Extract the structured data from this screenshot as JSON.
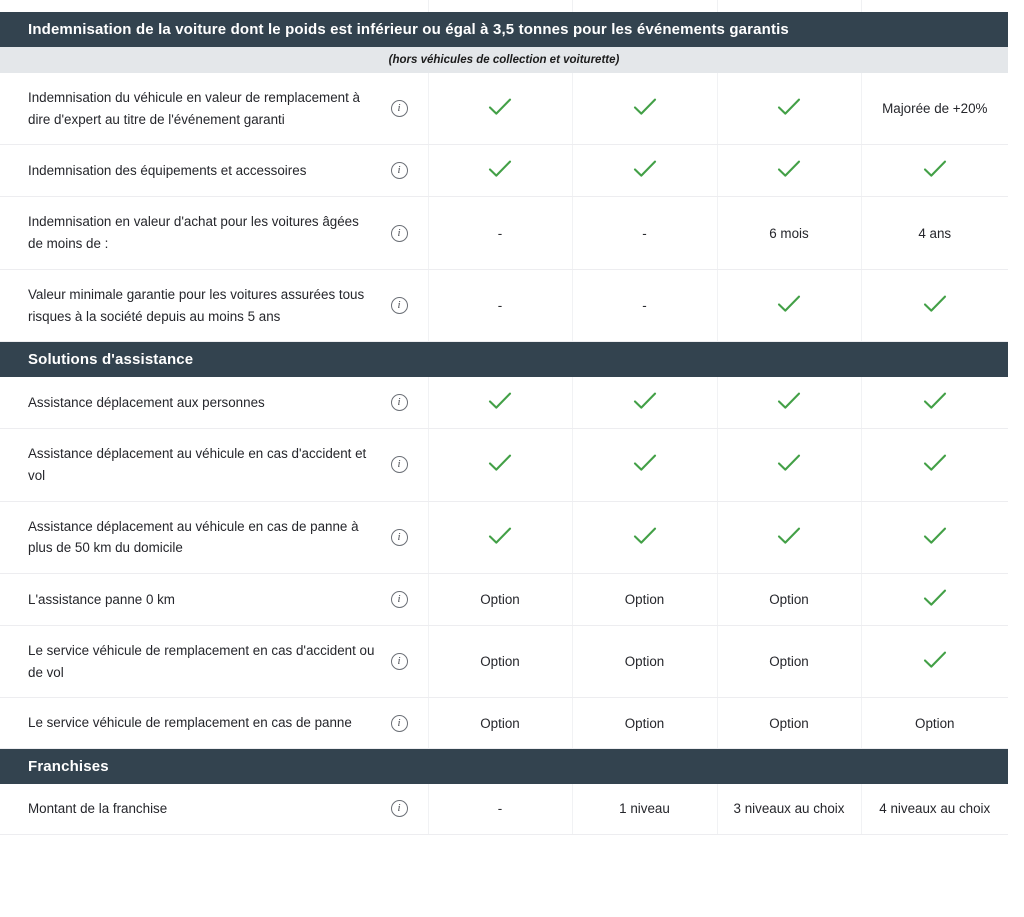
{
  "theme": {
    "section_header_bg": "#33434f",
    "section_header_text": "#ffffff",
    "subtitle_bg": "#e4e7ea",
    "check_color": "#43a047",
    "row_border": "#ededf0",
    "text_color": "#25262b"
  },
  "icons": {
    "info": "info-icon",
    "check": "check-icon"
  },
  "sections": [
    {
      "title": "Indemnisation de la voiture dont le poids est inférieur ou égal à 3,5 tonnes pour les événements garantis",
      "subtitle": "(hors véhicules de collection et voiturette)",
      "rows": [
        {
          "label": "Indemnisation du véhicule en valeur de remplacement à dire d'expert au titre de l'événement garanti",
          "values": [
            "check",
            "check",
            "check",
            "Majorée de +20%"
          ]
        },
        {
          "label": "Indemnisation des équipements et accessoires",
          "values": [
            "check",
            "check",
            "check",
            "check"
          ]
        },
        {
          "label": "Indemnisation en valeur d'achat pour les voitures âgées de moins de :",
          "values": [
            "-",
            "-",
            "6 mois",
            "4 ans"
          ]
        },
        {
          "label": "Valeur minimale garantie pour les voitures assurées tous risques à la société depuis au moins 5 ans",
          "values": [
            "-",
            "-",
            "check",
            "check"
          ]
        }
      ]
    },
    {
      "title": "Solutions d'assistance",
      "subtitle": null,
      "rows": [
        {
          "label": "Assistance déplacement aux personnes",
          "values": [
            "check",
            "check",
            "check",
            "check"
          ]
        },
        {
          "label": "Assistance déplacement au véhicule en cas d'accident et vol",
          "values": [
            "check",
            "check",
            "check",
            "check"
          ]
        },
        {
          "label": "Assistance déplacement au véhicule en cas de panne à plus de 50 km du domicile",
          "values": [
            "check",
            "check",
            "check",
            "check"
          ]
        },
        {
          "label": "L'assistance panne 0 km",
          "values": [
            "Option",
            "Option",
            "Option",
            "check"
          ]
        },
        {
          "label": "Le service véhicule de remplacement en cas d'accident ou de vol",
          "values": [
            "Option",
            "Option",
            "Option",
            "check"
          ]
        },
        {
          "label": "Le service véhicule de remplacement en cas de panne",
          "values": [
            "Option",
            "Option",
            "Option",
            "Option"
          ]
        }
      ]
    },
    {
      "title": "Franchises",
      "subtitle": null,
      "rows": [
        {
          "label": "Montant de la franchise",
          "values": [
            "-",
            "1 niveau",
            "3 niveaux au choix",
            "4 niveaux au choix"
          ]
        }
      ]
    }
  ]
}
